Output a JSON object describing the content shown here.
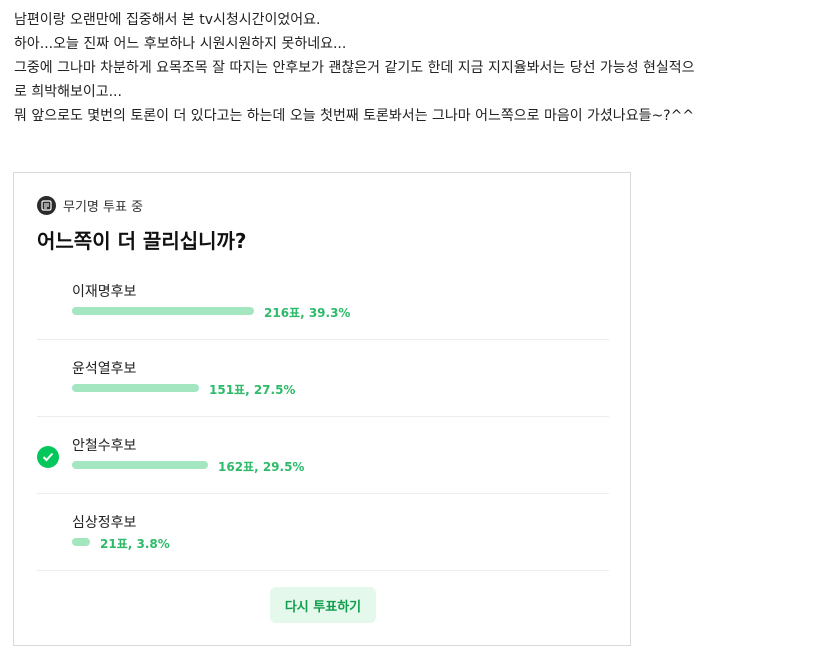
{
  "post": {
    "lines": [
      "남편이랑 오랜만에 집중해서 본 tv시청시간이었어요.",
      "하아...오늘 진짜 어느 후보하나 시원시원하지 못하네요...",
      "그중에 그나마 차분하게 요목조목 잘 따지는 안후보가 괜찮은거 같기도 한데 지금 지지율봐서는 당선 가능성 현실적으",
      "로 희박해보이고...",
      "뭐 앞으로도 몇번의 토론이 더 있다고는 하는데 오늘 첫번째 토론봐서는 그나마 어느쪽으로 마음이 가셨나요들~?^^"
    ]
  },
  "poll": {
    "status": "무기명 투표 중",
    "status_icon": "vote-icon",
    "title": "어느쪽이 더 끌리십니까?",
    "accent_color": "#03c75a",
    "bar_color": "#a3e6bf",
    "options": [
      {
        "label": "이재명후보",
        "votes": 216,
        "percent": 39.3,
        "stats": "216표, 39.3%",
        "selected": false
      },
      {
        "label": "윤석열후보",
        "votes": 151,
        "percent": 27.5,
        "stats": "151표, 27.5%",
        "selected": false
      },
      {
        "label": "안철수후보",
        "votes": 162,
        "percent": 29.5,
        "stats": "162표, 29.5%",
        "selected": true
      },
      {
        "label": "심상정후보",
        "votes": 21,
        "percent": 3.8,
        "stats": "21표, 3.8%",
        "selected": false
      }
    ],
    "revote_label": "다시 투표하기"
  }
}
